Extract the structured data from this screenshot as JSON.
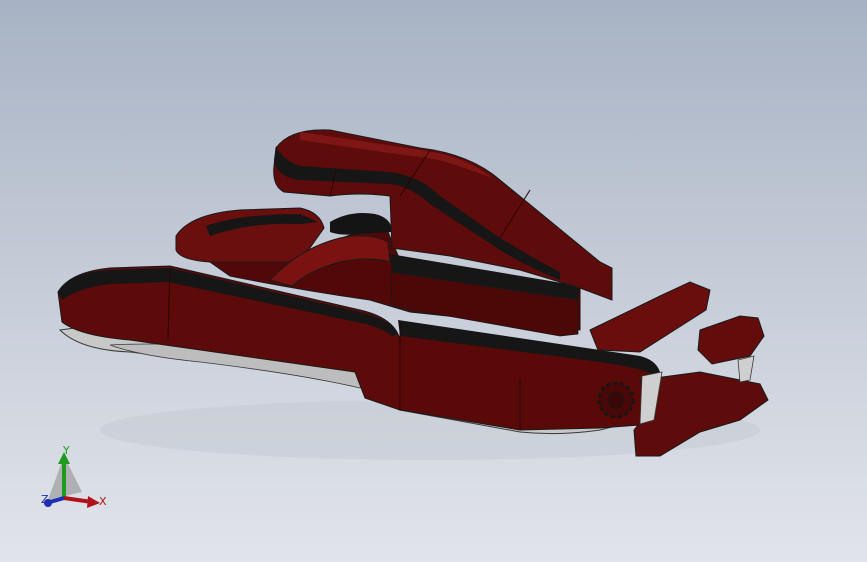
{
  "viewport": {
    "background_top": "#a7b2c4",
    "background_bottom": "#e1e4ea",
    "model": {
      "icon": "speedboat-hull-model",
      "body_color": "#5c0a0a",
      "body_highlight_color": "#7a1212",
      "stripe_color": "#161616",
      "hull_underside_color": "#c8c8c8"
    }
  },
  "triad": {
    "x_label": "X",
    "y_label": "Y",
    "z_label": "Z",
    "x_color": "#b0121c",
    "y_color": "#1e9a1e",
    "z_color": "#1c2fb5"
  }
}
